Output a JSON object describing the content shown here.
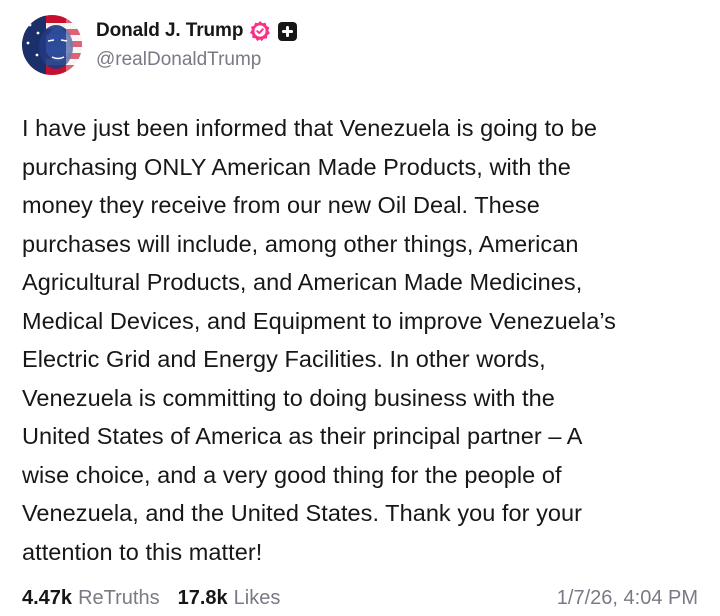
{
  "author": {
    "display_name": "Donald J. Trump",
    "handle": "@realDonaldTrump",
    "verified_icon": "verified-badge-icon",
    "extra_icon": "plus-icon",
    "colors": {
      "verified": "#ff2e83",
      "plus_badge": "#17171a"
    }
  },
  "post": {
    "lines": [
      "I have just been informed that Venezuela is going to be",
      "purchasing ONLY American Made Products, with the",
      "money they receive from our new Oil Deal. These",
      "purchases will include, among other things, American",
      "Agricultural Products, and American Made Medicines,",
      "Medical Devices, and Equipment to improve Venezuela’s",
      "Electric Grid and Energy Facilities. In other words,",
      "Venezuela is committing to doing business with the",
      "United States of America as their principal partner – A",
      "wise choice, and a very good thing for the people of",
      "Venezuela, and the United States. Thank you for your",
      "attention to this matter!"
    ]
  },
  "stats": {
    "retruths_count": "4.47k",
    "retruths_label": "ReTruths",
    "likes_count": "17.8k",
    "likes_label": "Likes",
    "timestamp": "1/7/26, 4:04 PM"
  }
}
